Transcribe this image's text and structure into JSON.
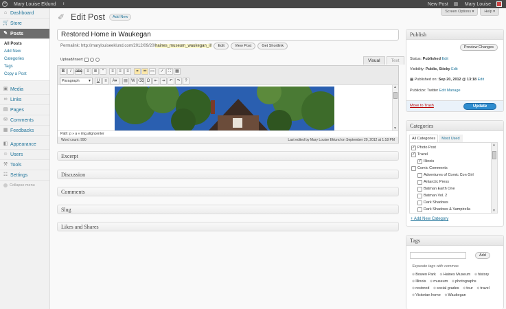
{
  "adminbar": {
    "site_name": "Mary Louise Eklund",
    "stats_glyph": "ılıl",
    "new_post": "New Post",
    "user": "Mary Louise",
    "wp_logo": "W"
  },
  "screen_tabs": {
    "options": "Screen Options ▾",
    "help": "Help ▾"
  },
  "sidebar": {
    "items_top": [
      {
        "label": "Dashboard",
        "icon": "⌂"
      },
      {
        "label": "Store",
        "icon": "🛒"
      }
    ],
    "posts": {
      "label": "Posts",
      "icon": "✎"
    },
    "posts_sub": [
      "All Posts",
      "Add New",
      "Categories",
      "Tags",
      "Copy a Post"
    ],
    "items_mid": [
      {
        "label": "Media",
        "icon": "▣"
      },
      {
        "label": "Links",
        "icon": "∞"
      },
      {
        "label": "Pages",
        "icon": "▤"
      },
      {
        "label": "Comments",
        "icon": "✉"
      },
      {
        "label": "Feedbacks",
        "icon": "▦"
      }
    ],
    "items_bottom": [
      {
        "label": "Appearance",
        "icon": "◧"
      },
      {
        "label": "Users",
        "icon": "☺"
      },
      {
        "label": "Tools",
        "icon": "⚒"
      },
      {
        "label": "Settings",
        "icon": "☷"
      }
    ],
    "collapse": "Collapse menu"
  },
  "header": {
    "title": "Edit Post",
    "add_new": "Add New"
  },
  "post": {
    "title": "Restored Home in Waukegan",
    "permalink_label": "Permalink:",
    "permalink_base": "http://marylouiseeklund.com/2012/09/20/",
    "permalink_slug": "haines_museum_waukegan_il/",
    "edit": "Edit",
    "view_post": "View Post",
    "get_shortlink": "Get Shortlink"
  },
  "editor": {
    "upload_label": "Upload/Insert",
    "tab_visual": "Visual",
    "tab_text": "Text",
    "format_select": "Paragraph",
    "path": "Path: p » a » img.aligncenter",
    "word_count": "Word count: 990",
    "last_edited": "Last edited by Mary Louise Eklund on September 20, 2012 at 1:18 PM"
  },
  "metaboxes": [
    "Excerpt",
    "Discussion",
    "Comments",
    "Slug",
    "Likes and Shares"
  ],
  "publish": {
    "title": "Publish",
    "preview": "Preview Changes",
    "status_label": "Status: ",
    "status_value": "Published",
    "visibility_label": "Visibility: ",
    "visibility_value": "Public, Sticky",
    "published_label": "Published on: ",
    "published_value": "Sep 20, 2012 @ 13:18",
    "publicize_label": "Publicize: Twitter",
    "edit": "Edit",
    "manage": "Manage",
    "trash": "Move to Trash",
    "update": "Update"
  },
  "categories": {
    "title": "Categories",
    "tab_all": "All Categories",
    "tab_used": "Most Used",
    "items": [
      {
        "label": "Photo Post",
        "checked": true,
        "indent": 0
      },
      {
        "label": "Travel",
        "checked": true,
        "indent": 0
      },
      {
        "label": "Illinois",
        "checked": true,
        "indent": 1
      },
      {
        "label": "Comic Comments",
        "checked": false,
        "indent": 0
      },
      {
        "label": "Adventures of Comic Con Girl",
        "checked": false,
        "indent": 1
      },
      {
        "label": "Antarctic Press",
        "checked": false,
        "indent": 1
      },
      {
        "label": "Batman Earth One",
        "checked": false,
        "indent": 1
      },
      {
        "label": "Batman Vol. 2",
        "checked": false,
        "indent": 1
      },
      {
        "label": "Dark Shadows",
        "checked": false,
        "indent": 1
      },
      {
        "label": "Dark Shadows & Vampirella",
        "checked": false,
        "indent": 1
      }
    ],
    "add_new": "+ Add New Category"
  },
  "tags": {
    "title": "Tags",
    "add": "Add",
    "help": "Separate tags with commas",
    "items": [
      "Bowen Park",
      "Haines Museum",
      "history",
      "Illinois",
      "museum",
      "photographs",
      "restored",
      "social grades",
      "tour",
      "travel",
      "Victorian home",
      "Waukegan"
    ]
  }
}
